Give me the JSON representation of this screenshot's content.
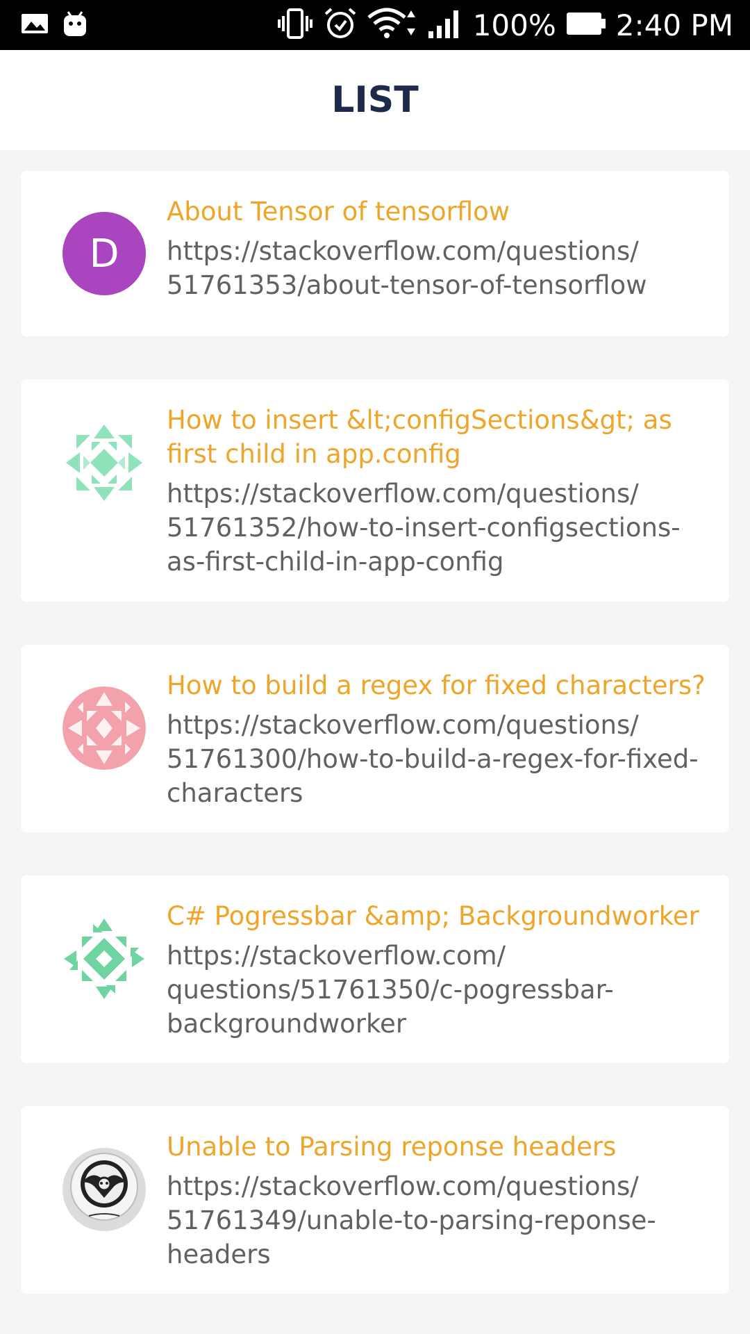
{
  "status_bar": {
    "battery": "100%",
    "time": "2:40 PM",
    "icons": [
      "gallery-icon",
      "android-icon",
      "vibrate-icon",
      "alarm-icon",
      "wifi-icon",
      "signal-icon",
      "battery-icon"
    ]
  },
  "app_bar": {
    "title": "LIST"
  },
  "items": [
    {
      "title": "About Tensor of tensorflow",
      "url_lines": [
        "https://stackoverflow.com/questions/",
        "51761353/about-tensor-of-tensorflow"
      ],
      "avatar": {
        "type": "letter",
        "letter": "D",
        "color": "#a845bf"
      }
    },
    {
      "title_lines": [
        "How to insert &lt;configSections&gt; as",
        "first child in app.config"
      ],
      "url_lines": [
        "https://stackoverflow.com/questions/",
        "51761352/how-to-insert-configsections-",
        "as-first-child-in-app-config"
      ],
      "avatar": {
        "type": "identicon",
        "color": "#8fe3b8"
      }
    },
    {
      "title": "How to build a regex for fixed characters?",
      "url_lines": [
        "https://stackoverflow.com/questions/",
        "51761300/how-to-build-a-regex-for-fixed-",
        "characters"
      ],
      "avatar": {
        "type": "identicon",
        "color": "#f3a1ab"
      }
    },
    {
      "title": "C# Pogressbar &amp; Backgroundworker",
      "url_lines": [
        "https://stackoverflow.com/",
        "questions/51761350/c-pogressbar-",
        "backgroundworker"
      ],
      "avatar": {
        "type": "identicon",
        "color": "#6fd4a0"
      }
    },
    {
      "title": "Unable to Parsing reponse headers",
      "url_lines": [
        "https://stackoverflow.com/questions/",
        "51761349/unable-to-parsing-reponse-",
        "headers"
      ],
      "avatar": {
        "type": "photo",
        "icon": "winged-skull-logo-icon"
      }
    }
  ]
}
